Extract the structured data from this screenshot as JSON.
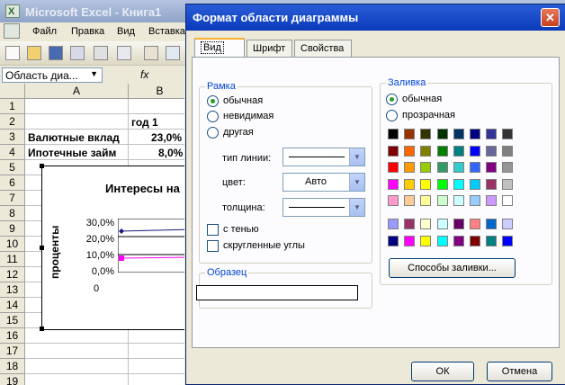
{
  "excel": {
    "title": "Microsoft Excel - Книга1",
    "icon_letter": "X",
    "menu": [
      "Файл",
      "Правка",
      "Вид",
      "Вставка"
    ],
    "name_box": "Область диа...",
    "fx_symbol": "fx",
    "columns": [
      "A",
      "B"
    ],
    "rows": [
      "1",
      "2",
      "3",
      "4",
      "5",
      "6",
      "7",
      "8",
      "9",
      "10",
      "11",
      "12",
      "13",
      "14",
      "15",
      "16",
      "17",
      "18",
      "19"
    ],
    "cells": {
      "b2": "год 1",
      "a3": "Валютные вклад",
      "b3": "23,0%",
      "a4": "Ипотечные займ",
      "b4": "8,0%"
    },
    "chart": {
      "title": "Интересы на",
      "ylabel": "проценты",
      "yticks": [
        "30,0%",
        "20,0%",
        "10,0%",
        "0,0%"
      ],
      "xtick": "0"
    }
  },
  "chart_data": {
    "type": "line",
    "title": "Интересы на",
    "ylabel": "проценты",
    "ylim": [
      0,
      30
    ],
    "yticks": [
      "30,0%",
      "20,0%",
      "10,0%",
      "0,0%"
    ],
    "xticks": [
      "0"
    ],
    "series": [
      {
        "values": [
          23.0
        ],
        "color": "#1a1a80"
      },
      {
        "values": [
          8.0
        ],
        "color": "#ff00ff"
      }
    ]
  },
  "dialog": {
    "title": "Формат области диаграммы",
    "close_glyph": "✕",
    "tabs": [
      "Вид",
      "Шрифт",
      "Свойства"
    ],
    "border_group": {
      "title": "Рамка",
      "options": [
        "обычная",
        "невидимая",
        "другая"
      ],
      "selected": 0,
      "line_type_label": "тип линии:",
      "color_label": "цвет:",
      "color_value": "Авто",
      "thickness_label": "толщина:",
      "shadow_label": "с тенью",
      "rounded_label": "скругленные углы"
    },
    "sample_group": {
      "title": "Образец"
    },
    "fill_group": {
      "title": "Заливка",
      "options": [
        "обычная",
        "прозрачная"
      ],
      "selected": 0,
      "palette_main": [
        [
          "#000000",
          "#993300",
          "#333300",
          "#003300",
          "#003366",
          "#000080",
          "#333399",
          "#333333"
        ],
        [
          "#800000",
          "#ff6600",
          "#808000",
          "#008000",
          "#008080",
          "#0000ff",
          "#666699",
          "#808080"
        ],
        [
          "#ff0000",
          "#ff9900",
          "#99cc00",
          "#339966",
          "#33cccc",
          "#3366ff",
          "#800080",
          "#969696"
        ],
        [
          "#ff00ff",
          "#ffcc00",
          "#ffff00",
          "#00ff00",
          "#00ffff",
          "#00ccff",
          "#993366",
          "#c0c0c0"
        ],
        [
          "#ff99cc",
          "#ffcc99",
          "#ffff99",
          "#ccffcc",
          "#ccffff",
          "#99ccff",
          "#cc99ff",
          "#ffffff"
        ]
      ],
      "palette_extra": [
        [
          "#9999ff",
          "#993366",
          "#ffffcc",
          "#ccffff",
          "#660066",
          "#ff8080",
          "#0066cc",
          "#ccccff"
        ],
        [
          "#000080",
          "#ff00ff",
          "#ffff00",
          "#00ffff",
          "#800080",
          "#800000",
          "#008080",
          "#0000ff"
        ]
      ],
      "fill_methods_label": "Способы заливки..."
    },
    "ok_label": "ОК",
    "cancel_label": "Отмена"
  }
}
